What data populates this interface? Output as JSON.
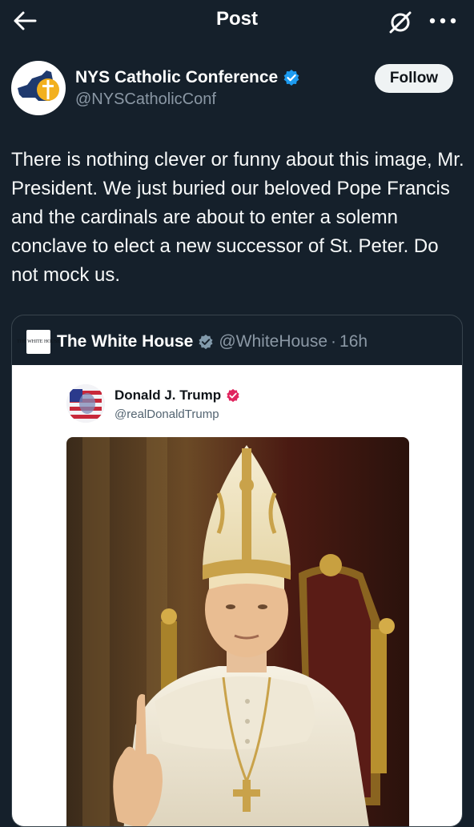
{
  "topbar": {
    "title": "Post",
    "back_icon": "arrow-left-icon",
    "grok_icon": "grok-icon",
    "more_icon": "more-horizontal-icon"
  },
  "post": {
    "author_name": "NYS Catholic Conference",
    "author_handle": "@NYSCatholicConf",
    "follow_label": "Follow",
    "text": "There is nothing clever or funny about this image, Mr. President. We just buried our beloved Pope Francis and the cardinals are about to enter a solemn conclave to elect a new successor of St. Peter. Do not mock us."
  },
  "quote": {
    "avatar_text": "THE WHITE HOUSE",
    "name": "The White House",
    "handle": "@WhiteHouse",
    "separator": "·",
    "time": "16h",
    "inner_post": {
      "name": "Donald J. Trump",
      "handle": "@realDonaldTrump"
    }
  },
  "colors": {
    "background": "#15202b",
    "verified_blue": "#1d9bf0",
    "verified_gray": "#829aab",
    "verified_pink": "#e0245e",
    "secondary_text": "#8b98a5"
  }
}
